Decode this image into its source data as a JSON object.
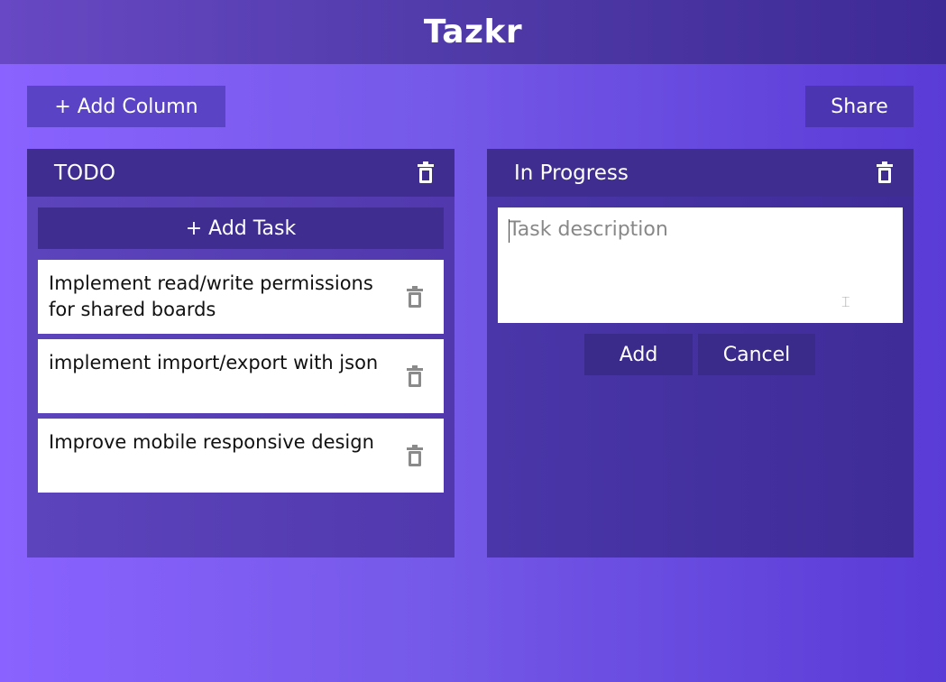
{
  "app": {
    "title": "Tazkr"
  },
  "toolbar": {
    "add_column_label": "+ Add Column",
    "share_label": "Share"
  },
  "columns": [
    {
      "title": "TODO",
      "add_task_label": "+ Add Task",
      "delete_icon": "trash-icon",
      "tasks": [
        {
          "text": "Implement read/write permissions for shared boards"
        },
        {
          "text": "implement import/export with json"
        },
        {
          "text": "Improve mobile responsive design"
        }
      ]
    },
    {
      "title": "In Progress",
      "delete_icon": "trash-icon",
      "new_task_form": {
        "placeholder": "Task description",
        "value": "",
        "add_label": "Add",
        "cancel_label": "Cancel"
      }
    }
  ],
  "colors": {
    "background_start": "#8a62ff",
    "background_end": "#5a3bd6",
    "header": "#4f3aa8",
    "column_header": "#3f2e8f",
    "button": "#3f2e8f",
    "task_card": "#ffffff",
    "icon_muted": "#8a8a8a"
  }
}
